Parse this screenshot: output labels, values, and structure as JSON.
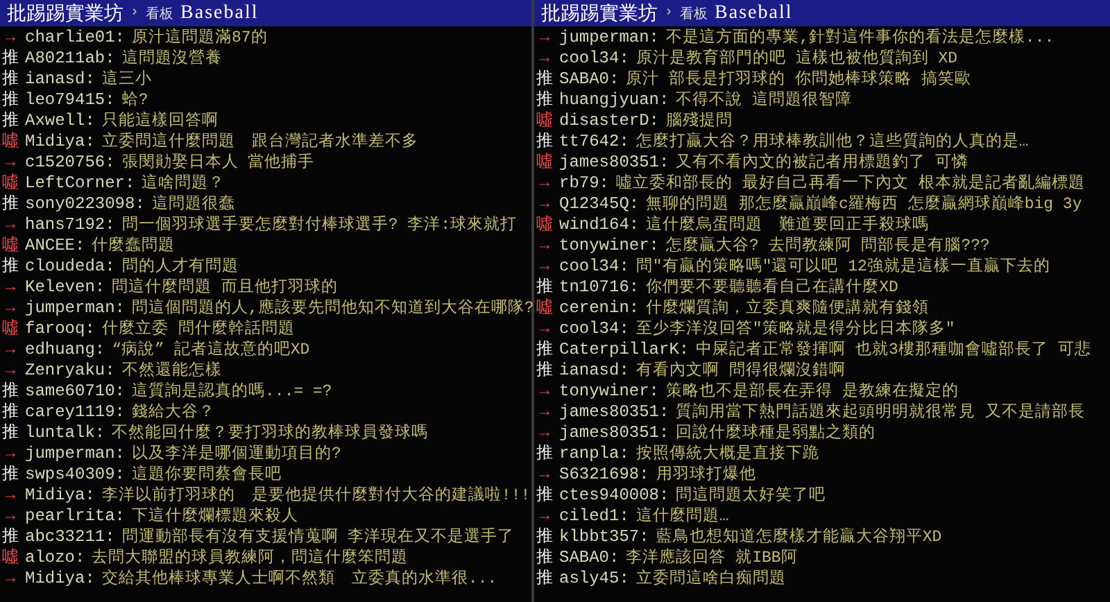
{
  "panes": [
    {
      "header": {
        "site": "批踢踢實業坊",
        "separator": "›",
        "board_label": "看板",
        "board": "Baseball"
      },
      "comments": [
        {
          "kind": "arrow",
          "mark": "→",
          "user": "charlie01:",
          "text": "原汁這問題滿87的"
        },
        {
          "kind": "push",
          "mark": "推",
          "user": "A80211ab:",
          "text": "這問題沒營養"
        },
        {
          "kind": "push",
          "mark": "推",
          "user": "ianasd:",
          "text": "這三小"
        },
        {
          "kind": "push",
          "mark": "推",
          "user": "leo79415:",
          "text": "蛤?"
        },
        {
          "kind": "push",
          "mark": "推",
          "user": "Axwell:",
          "text": "只能這樣回答啊"
        },
        {
          "kind": "boo",
          "mark": "噓",
          "user": "Midiya:",
          "text": "立委問這什麼問題　跟台灣記者水準差不多"
        },
        {
          "kind": "arrow",
          "mark": "→",
          "user": "c1520756:",
          "text": "張閔勛娶日本人 當他捕手"
        },
        {
          "kind": "boo",
          "mark": "噓",
          "user": "LeftCorner:",
          "text": "這啥問題？"
        },
        {
          "kind": "push",
          "mark": "推",
          "user": "sony0223098:",
          "text": "這問題很蠢"
        },
        {
          "kind": "arrow",
          "mark": "→",
          "user": "hans7192:",
          "text": "問一個羽球選手要怎麼對付棒球選手? 李洋:球來就打"
        },
        {
          "kind": "boo",
          "mark": "噓",
          "user": "ANCEE:",
          "text": "什麼蠢問題"
        },
        {
          "kind": "push",
          "mark": "推",
          "user": "cloudeda:",
          "text": "問的人才有問題"
        },
        {
          "kind": "arrow",
          "mark": "→",
          "user": "Keleven:",
          "text": "問這什麼問題 而且他打羽球的"
        },
        {
          "kind": "arrow",
          "mark": "→",
          "user": "jumperman:",
          "text": "問這個問題的人,應該要先問他知不知道到大谷在哪隊?"
        },
        {
          "kind": "boo",
          "mark": "噓",
          "user": "farooq:",
          "text": "什麼立委 問什麼幹話問題"
        },
        {
          "kind": "arrow",
          "mark": "→",
          "user": "edhuang:",
          "text": "“病說” 記者這故意的吧XD"
        },
        {
          "kind": "arrow",
          "mark": "→",
          "user": "Zenryaku:",
          "text": "不然還能怎樣"
        },
        {
          "kind": "push",
          "mark": "推",
          "user": "same60710:",
          "text": "這質詢是認真的嗎...= =?"
        },
        {
          "kind": "push",
          "mark": "推",
          "user": "carey1119:",
          "text": "錢給大谷？"
        },
        {
          "kind": "push",
          "mark": "推",
          "user": "luntalk:",
          "text": "不然能回什麼？要打羽球的教棒球員發球嗎"
        },
        {
          "kind": "arrow",
          "mark": "→",
          "user": "jumperman:",
          "text": "以及李洋是哪個運動項目的?"
        },
        {
          "kind": "push",
          "mark": "推",
          "user": "swps40309:",
          "text": "這題你要問蔡會長吧"
        },
        {
          "kind": "arrow",
          "mark": "→",
          "user": "Midiya:",
          "text": "李洋以前打羽球的　是要他提供什麼對付大谷的建議啦!!!"
        },
        {
          "kind": "arrow",
          "mark": "→",
          "user": "pearlrita:",
          "text": "下這什麼爛標題來殺人"
        },
        {
          "kind": "push",
          "mark": "推",
          "user": "abc33211:",
          "text": "問運動部長有沒有支援情蒐啊 李洋現在又不是選手了"
        },
        {
          "kind": "boo",
          "mark": "噓",
          "user": "alozo:",
          "text": "去問大聯盟的球員教練阿，問這什麼笨問題"
        },
        {
          "kind": "arrow",
          "mark": "→",
          "user": "Midiya:",
          "text": "交給其他棒球專業人士啊不然類　立委真的水準很..."
        }
      ]
    },
    {
      "header": {
        "site": "批踢踢實業坊",
        "separator": "›",
        "board_label": "看板",
        "board": "Baseball"
      },
      "comments": [
        {
          "kind": "arrow",
          "mark": "→",
          "user": "jumperman:",
          "text": "不是這方面的專業,針對這件事你的看法是怎麼樣..."
        },
        {
          "kind": "arrow",
          "mark": "→",
          "user": "cool34:",
          "text": "原汁是教育部門的吧 這樣也被他質詢到 XD"
        },
        {
          "kind": "push",
          "mark": "推",
          "user": "SABA0:",
          "text": "原汁 部長是打羽球的 你問她棒球策略 搞笑歐"
        },
        {
          "kind": "push",
          "mark": "推",
          "user": "huangjyuan:",
          "text": "不得不說 這問題很智障"
        },
        {
          "kind": "boo",
          "mark": "噓",
          "user": "disasterD:",
          "text": "腦殘提問"
        },
        {
          "kind": "push",
          "mark": "推",
          "user": "tt7642:",
          "text": "怎麼打贏大谷？用球棒教訓他？這些質詢的人真的是…"
        },
        {
          "kind": "boo",
          "mark": "噓",
          "user": "james80351:",
          "text": "又有不看內文的被記者用標題釣了 可憐"
        },
        {
          "kind": "arrow",
          "mark": "→",
          "user": "rb79:",
          "text": "噓立委和部長的 最好自己再看一下內文 根本就是記者亂編標題"
        },
        {
          "kind": "arrow",
          "mark": "→",
          "user": "Q12345Q:",
          "text": "無聊的問題 那怎麼贏巔峰c羅梅西 怎麼贏網球巔峰big 3y"
        },
        {
          "kind": "boo",
          "mark": "噓",
          "user": "wind164:",
          "text": "這什麼烏蛋問題　難道要回正手殺球嗎"
        },
        {
          "kind": "arrow",
          "mark": "→",
          "user": "tonywiner:",
          "text": "怎麼贏大谷? 去問教練阿 問部長是有腦???"
        },
        {
          "kind": "arrow",
          "mark": "→",
          "user": "cool34:",
          "text": "問\"有贏的策略嗎\"還可以吧 12強就是這樣一直贏下去的"
        },
        {
          "kind": "push",
          "mark": "推",
          "user": "tn10716:",
          "text": "你們要不要聽聽看自己在講什麼XD"
        },
        {
          "kind": "boo",
          "mark": "噓",
          "user": "cerenin:",
          "text": "什麼爛質詢，立委真爽隨便講就有錢領"
        },
        {
          "kind": "arrow",
          "mark": "→",
          "user": "cool34:",
          "text": "至少李洋沒回答\"策略就是得分比日本隊多\""
        },
        {
          "kind": "push",
          "mark": "推",
          "user": "CaterpillarK:",
          "text": "中屎記者正常發揮啊 也就3樓那種咖會噓部長了 可悲"
        },
        {
          "kind": "push",
          "mark": "推",
          "user": "ianasd:",
          "text": "有看內文啊 問得很爛沒錯啊"
        },
        {
          "kind": "arrow",
          "mark": "→",
          "user": "tonywiner:",
          "text": "策略也不是部長在弄得 是教練在擬定的"
        },
        {
          "kind": "arrow",
          "mark": "→",
          "user": "james80351:",
          "text": "質詢用當下熱門話題來起頭明明就很常見 又不是請部長"
        },
        {
          "kind": "arrow",
          "mark": "→",
          "user": "james80351:",
          "text": "回說什麼球種是弱點之類的"
        },
        {
          "kind": "push",
          "mark": "推",
          "user": "ranpla:",
          "text": "按照傳統大概是直接下跪"
        },
        {
          "kind": "arrow",
          "mark": "→",
          "user": "S6321698:",
          "text": "用羽球打爆他"
        },
        {
          "kind": "push",
          "mark": "推",
          "user": "ctes940008:",
          "text": "問這問題太好笑了吧"
        },
        {
          "kind": "arrow",
          "mark": "→",
          "user": "ciled1:",
          "text": "這什麼問題…"
        },
        {
          "kind": "push",
          "mark": "推",
          "user": "klbbt357:",
          "text": "藍鳥也想知道怎麼樣才能贏大谷翔平XD"
        },
        {
          "kind": "push",
          "mark": "推",
          "user": "SABA0:",
          "text": "李洋應該回答 就IBB阿"
        },
        {
          "kind": "push",
          "mark": "推",
          "user": "asly45:",
          "text": "立委問這啥白痴問題"
        }
      ]
    }
  ]
}
